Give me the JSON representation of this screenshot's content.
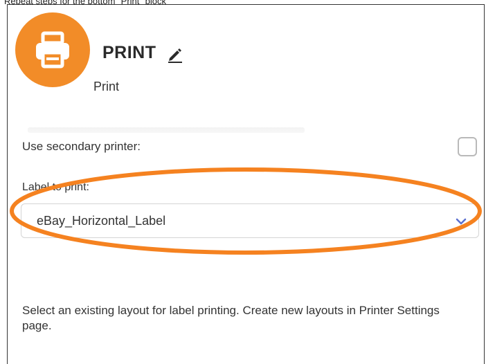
{
  "caption": "Repeat steps for the bottom \"Print\" block",
  "block": {
    "title": "PRINT",
    "subtitle": "Print",
    "icon": "printer-icon",
    "accent_color": "#f28c28"
  },
  "secondary_printer": {
    "label": "Use secondary printer:",
    "checked": false
  },
  "label_to_print": {
    "label": "Label to print:",
    "selected": "eBay_Horizontal_Label"
  },
  "help_text": "Select an existing layout for label printing. Create new layouts in Printer Settings page.",
  "annotation": {
    "highlight_color": "#f58220"
  }
}
